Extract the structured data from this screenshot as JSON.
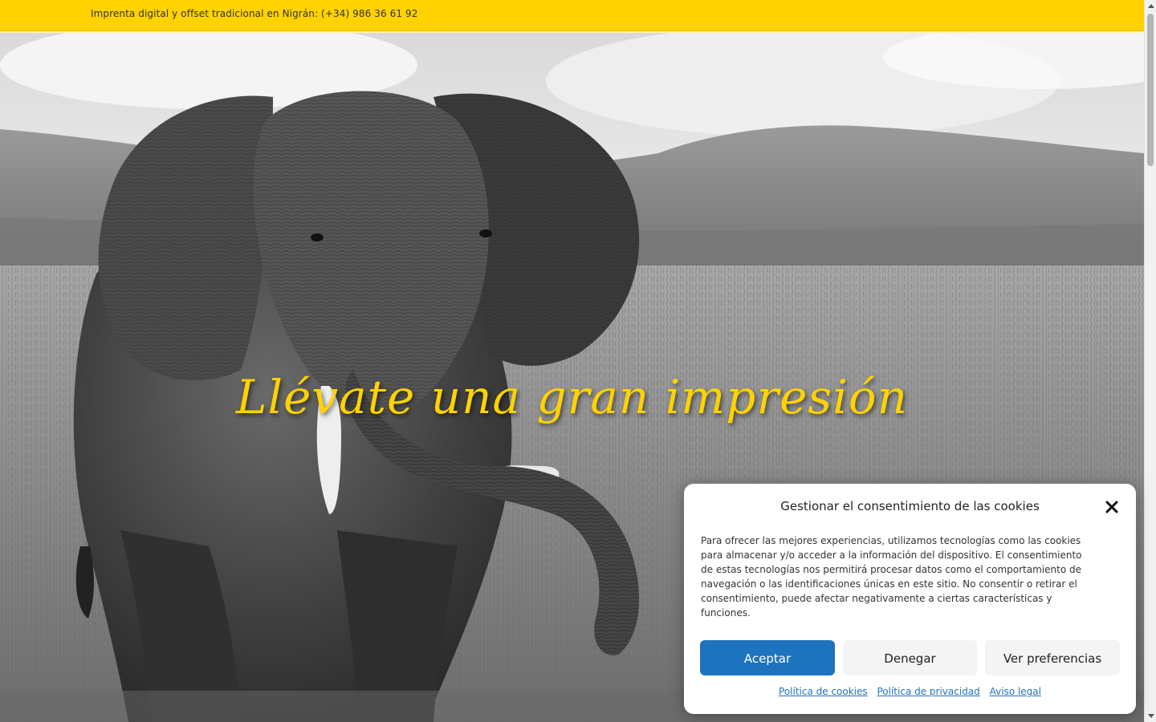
{
  "topbar": {
    "text": "Imprenta digital y offset tradicional en Nigrán: (+34) 986 36 61 92",
    "color": "#ffd200"
  },
  "hero": {
    "title": "Llévate una gran impresión",
    "title_color": "#ffd200",
    "image": "black-and-white photo of an elephant walking across a grassland savanna with hills behind"
  },
  "cookie_banner": {
    "title": "Gestionar el consentimiento de las cookies",
    "close_icon": "close-icon",
    "body": "Para ofrecer las mejores experiencias, utilizamos tecnologías como las cookies para almacenar y/o acceder a la información del dispositivo. El consentimiento de estas tecnologías nos permitirá procesar datos como el comportamiento de navegación o las identificaciones únicas en este sitio. No consentir o retirar el consentimiento, puede afectar negativamente a ciertas características y funciones.",
    "buttons": {
      "accept": "Aceptar",
      "deny": "Denegar",
      "preferences": "Ver preferencias"
    },
    "links": {
      "cookies_policy": "Política de cookies",
      "privacy_policy": "Política de privacidad",
      "legal_notice": "Aviso legal"
    },
    "accent_color": "#1e73be"
  }
}
